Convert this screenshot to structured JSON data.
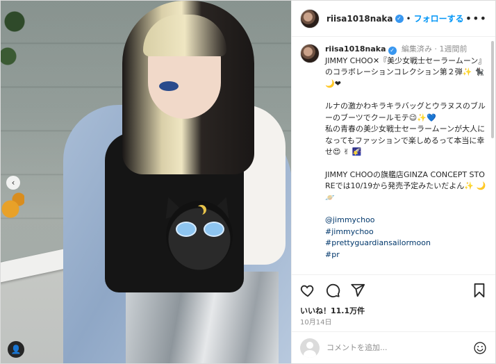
{
  "post": {
    "username": "riisa1018naka",
    "follow_label": "フォローする",
    "separator": "•",
    "more_label": "•••",
    "prev_label": "‹",
    "user_tag_label": "👤"
  },
  "caption": {
    "username": "riisa1018naka",
    "meta": "編集済み · 1週間前",
    "lines1": "JIMMY CHOO✕『美少女戦士セーラームーン』のコラボレーションコレクション第２弾✨ 🐈‍⬛ 🌙❤",
    "lines2": "ルナの激かわキラキラバッグとウラヌスのブルーのブーツでクールモテ😉✨💙",
    "lines3": "私の青春の美少女戦士セーラームーンが大人になってもファッションで楽しめるって本当に幸せ😍 ✌ 🌠",
    "lines4": "JIMMY CHOOの旗艦店GINZA CONCEPT STOREでは10/19から発売予定みたいだよん✨ 🌙 🪐",
    "links": [
      "@jimmychoo",
      "#jimmychoo",
      "#prettyguardiansailormoon",
      "#pr"
    ]
  },
  "actions": {
    "like_icon": "heart-icon",
    "comment_icon": "comment-icon",
    "share_icon": "share-icon",
    "save_icon": "bookmark-icon"
  },
  "stats": {
    "likes": "いいね！11.1万件",
    "date": "10月14日"
  },
  "comment": {
    "placeholder": "コメントを追加...",
    "emoji_icon": "smile-icon"
  },
  "colors": {
    "accent": "#0095f6",
    "verified": "#3897f0",
    "link": "#00376b"
  }
}
